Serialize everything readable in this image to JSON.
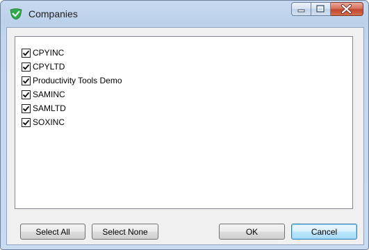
{
  "window": {
    "title": "Companies",
    "icon": "green-shield-check-icon"
  },
  "companies": [
    {
      "label": "CPYINC",
      "checked": true
    },
    {
      "label": "CPYLTD",
      "checked": true
    },
    {
      "label": "Productivity Tools Demo",
      "checked": true
    },
    {
      "label": "SAMINC",
      "checked": true
    },
    {
      "label": "SAMLTD",
      "checked": true
    },
    {
      "label": "SOXINC",
      "checked": true
    }
  ],
  "buttons": {
    "select_all": "Select All",
    "select_none": "Select None",
    "ok": "OK",
    "cancel": "Cancel"
  }
}
